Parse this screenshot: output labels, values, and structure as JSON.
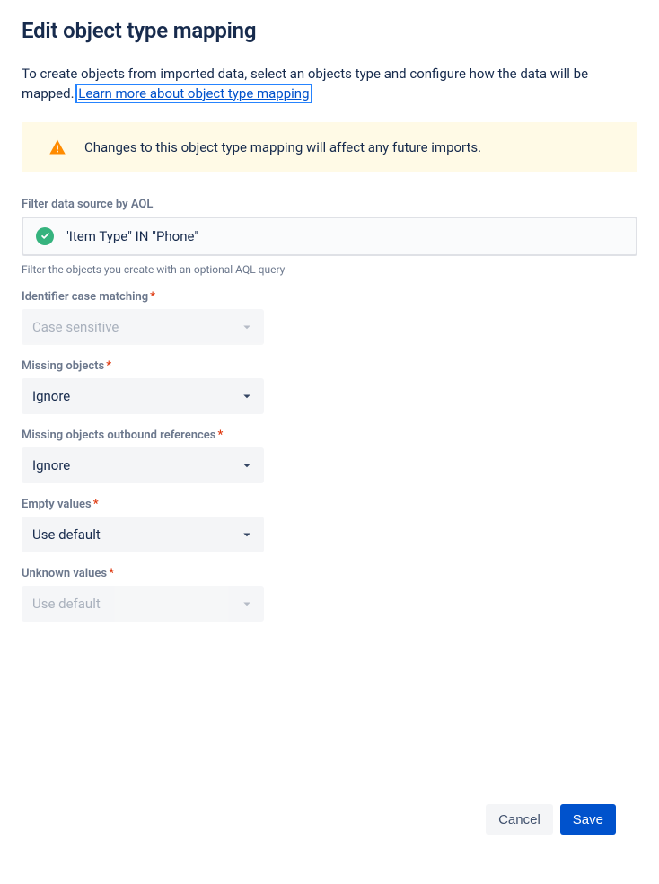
{
  "title": "Edit object type mapping",
  "description_before": "To create objects from imported data, select an objects type and configure how the data will be mapped. ",
  "learn_more": "Learn more about object type mapping",
  "banner": {
    "text": "Changes to this object type mapping will affect any future imports."
  },
  "aql": {
    "label": "Filter data source by AQL",
    "value": "\"Item Type\" IN \"Phone\"",
    "helper": "Filter the objects you create with an optional AQL query"
  },
  "fields": {
    "identifier_case": {
      "label": "Identifier case matching",
      "value": "Case sensitive",
      "required": true,
      "disabled": true
    },
    "missing_objects": {
      "label": "Missing objects",
      "value": "Ignore",
      "required": true,
      "disabled": false
    },
    "missing_outbound": {
      "label": "Missing objects outbound references",
      "value": "Ignore",
      "required": true,
      "disabled": false
    },
    "empty_values": {
      "label": "Empty values",
      "value": "Use default",
      "required": true,
      "disabled": false
    },
    "unknown_values": {
      "label": "Unknown values",
      "value": "Use default",
      "required": true,
      "disabled": true
    }
  },
  "buttons": {
    "cancel": "Cancel",
    "save": "Save"
  },
  "required_symbol": "*"
}
